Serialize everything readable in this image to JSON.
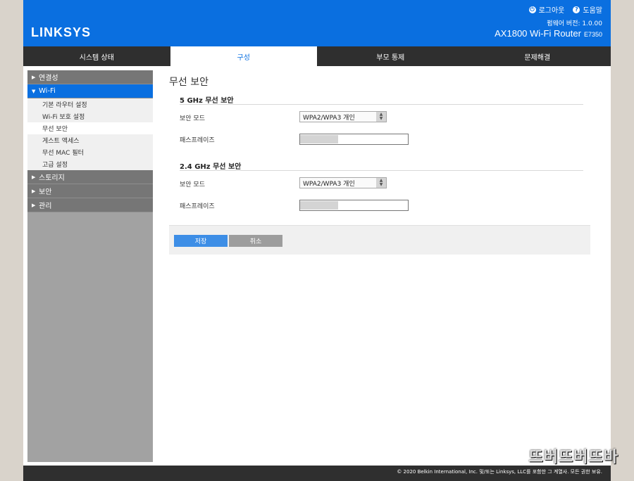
{
  "header": {
    "logo": "LINKSYS",
    "logout_label": "로그아웃",
    "help_label": "도움말",
    "firmware_label": "펌웨어 버전: 1.0.00",
    "model": "AX1800 Wi-Fi Router",
    "model_sub": "E7350"
  },
  "tabs": [
    {
      "label": "시스템 상태"
    },
    {
      "label": "구성"
    },
    {
      "label": "부모 통제"
    },
    {
      "label": "문제해결"
    }
  ],
  "sidebar": {
    "connectivity": "연결성",
    "wifi": "Wi-Fi",
    "wifi_items": [
      {
        "label": "기본 라우터 설정"
      },
      {
        "label": "Wi-Fi 보호 설정"
      },
      {
        "label": "무선 보안"
      },
      {
        "label": "게스트 액세스"
      },
      {
        "label": "무선 MAC 필터"
      },
      {
        "label": "고급 설정"
      }
    ],
    "storage": "스토리지",
    "security": "보안",
    "admin": "관리"
  },
  "main": {
    "title": "무선 보안",
    "sections": [
      {
        "title": "5 GHz 무선 보안",
        "mode_label": "보안 모드",
        "mode_value": "WPA2/WPA3 개인",
        "pass_label": "패스프레이즈"
      },
      {
        "title": "2.4 GHz 무선 보안",
        "mode_label": "보안 모드",
        "mode_value": "WPA2/WPA3 개인",
        "pass_label": "패스프레이즈"
      }
    ],
    "save_label": "저장",
    "cancel_label": "취소"
  },
  "footer": {
    "copyright": "© 2020 Belkin International, Inc. 및/또는 Linksys, LLC를 포함한 그 계열사. 모든 권한 보유."
  },
  "watermark": "뜨버뜨버뜨바",
  "colors": {
    "brand_blue": "#0a6fe0",
    "nav_dark": "#2f2f2f",
    "save_blue": "#3d8ee6"
  }
}
